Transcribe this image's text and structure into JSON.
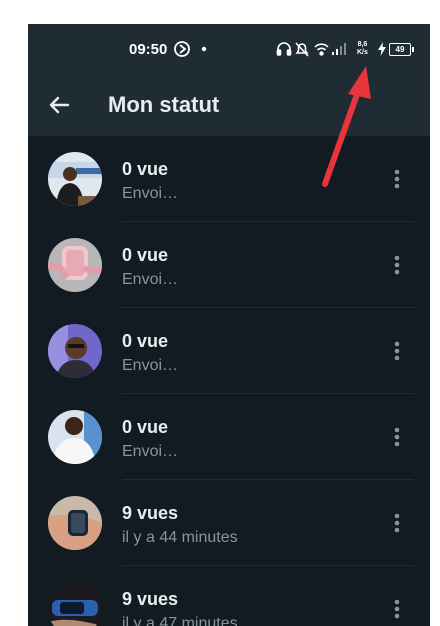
{
  "status_bar": {
    "time": "09:50",
    "net_speed_value": "8,6",
    "net_speed_unit": "K/s",
    "battery": "49"
  },
  "app_bar": {
    "title": "Mon statut"
  },
  "statuses": [
    {
      "views": "0 vue",
      "subtitle": "Envoi…"
    },
    {
      "views": "0 vue",
      "subtitle": "Envoi…"
    },
    {
      "views": "0 vue",
      "subtitle": "Envoi…"
    },
    {
      "views": "0 vue",
      "subtitle": "Envoi…"
    },
    {
      "views": "9 vues",
      "subtitle": "il y a 44 minutes"
    },
    {
      "views": "9 vues",
      "subtitle": "il y a 47 minutes"
    }
  ],
  "colors": {
    "background": "#111b21",
    "header": "#1f2c34",
    "primary_text": "#e9edef",
    "secondary_text": "#8696a0",
    "annotation_arrow": "#e8343a"
  },
  "icons": [
    "back-arrow-icon",
    "more-vert-icon",
    "headphones-icon",
    "bell-off-icon",
    "wifi-icon",
    "signal-icon",
    "charging-icon"
  ]
}
